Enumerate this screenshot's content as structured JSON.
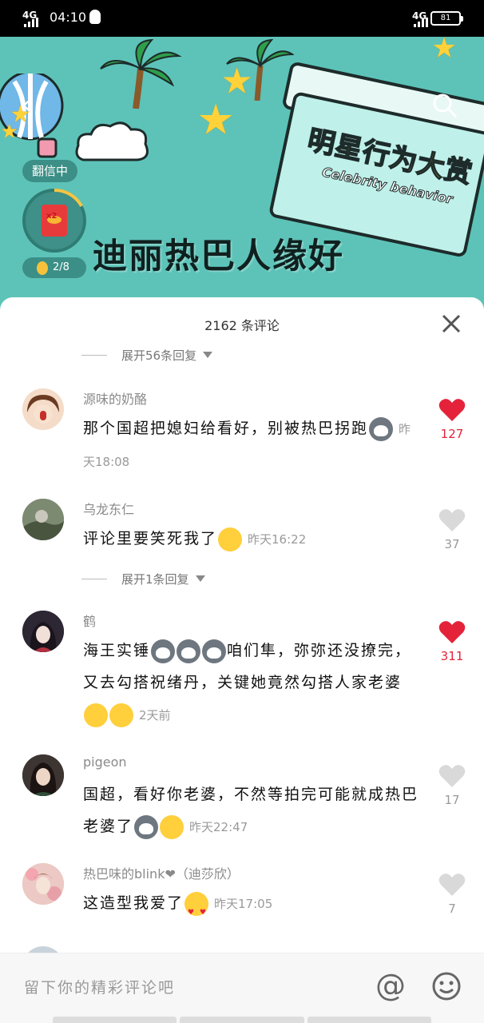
{
  "status_bar": {
    "network_left": "4G",
    "time": "04:10",
    "network_right": "4G",
    "battery": "81"
  },
  "banner": {
    "tv_title": "明星行为大赏",
    "tv_subtitle": "Celebrity behavior",
    "badge": "翻信中",
    "coin_progress": "2/8",
    "topic_title": "迪丽热巴人缘好"
  },
  "sheet": {
    "title": "2162 条评论",
    "comments": [
      {
        "username": "源味的奶酪",
        "text": "那个国超把媳妇给看好，别被热巴拐跑",
        "time": "昨天18:08",
        "likes": "127",
        "liked": true
      },
      {
        "username": "乌龙东仁",
        "text": "评论里要笑死我了",
        "time": "昨天16:22",
        "likes": "37",
        "liked": false
      },
      {
        "username": "鹤",
        "text_a": "海王实锤",
        "text_b": "咱们隼，弥弥还没撩完，又去勾搭祝绪丹，关键她竟然勾搭人家老婆",
        "time": "2天前",
        "likes": "311",
        "liked": true
      },
      {
        "username": "pigeon",
        "text": "国超，看好你老婆，不然等拍完可能就成热巴老婆了",
        "time": "昨天22:47",
        "likes": "17",
        "liked": false
      },
      {
        "username": "热巴味的blink❤（迪莎欣）",
        "text": "这造型我爱了",
        "time": "昨天17:05",
        "likes": "7",
        "liked": false
      }
    ],
    "expand_1": "展开56条回复",
    "expand_2": "展开1条回复"
  },
  "input": {
    "placeholder": "留下你的精彩评论吧"
  },
  "colors": {
    "teal": "#5dc3b8",
    "like_red": "#e4233b"
  }
}
